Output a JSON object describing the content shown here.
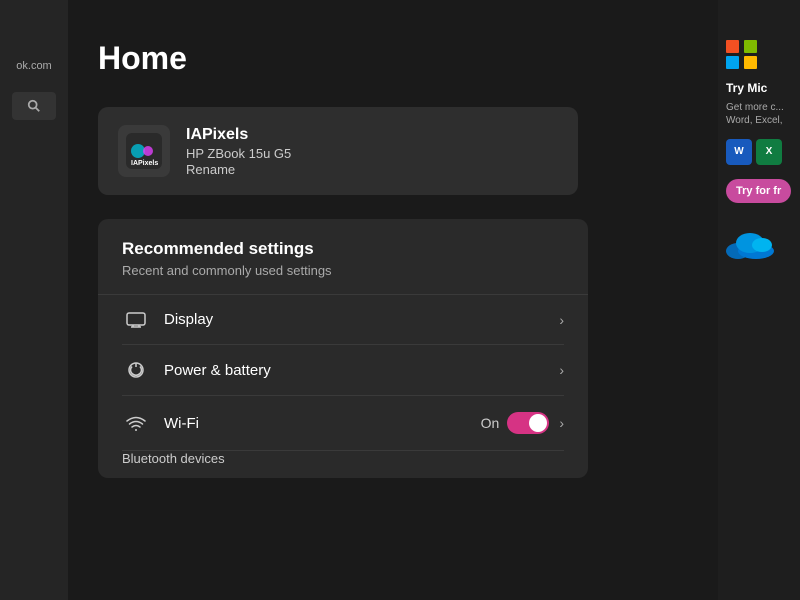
{
  "page": {
    "title": "Home"
  },
  "sidebar": {
    "site_name": "ok.com",
    "search_placeholder": "Search"
  },
  "device": {
    "name": "IAPixels",
    "model": "HP ZBook 15u G5",
    "rename_label": "Rename"
  },
  "recommended": {
    "title": "Recommended settings",
    "subtitle": "Recent and commonly used settings",
    "items": [
      {
        "id": "display",
        "label": "Display",
        "status": "",
        "has_toggle": false
      },
      {
        "id": "power",
        "label": "Power & battery",
        "status": "",
        "has_toggle": false
      },
      {
        "id": "wifi",
        "label": "Wi-Fi",
        "status": "On",
        "has_toggle": true
      }
    ],
    "partial_item": "Bluetooth devices"
  },
  "ad": {
    "title": "Try Mic",
    "subtitle": "Get more c... Word, Excel,",
    "app_w": "W",
    "app_x": "X",
    "try_label": "Try for fr"
  }
}
